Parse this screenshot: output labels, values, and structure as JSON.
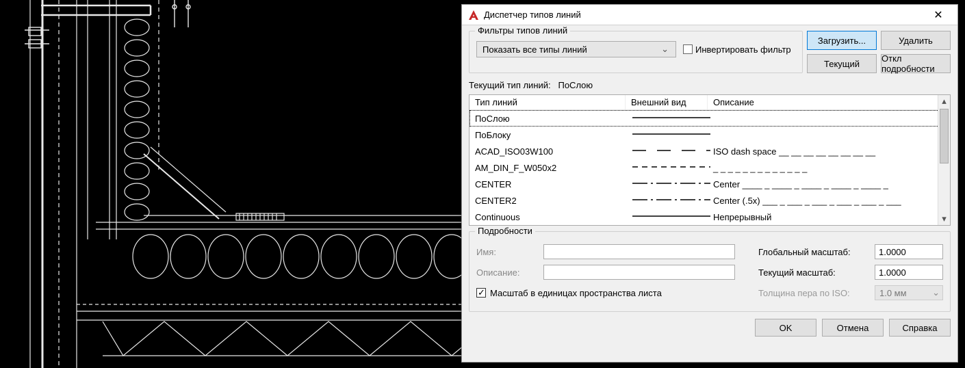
{
  "dialog": {
    "title": "Диспетчер типов линий",
    "close_icon_label": "✕"
  },
  "filters": {
    "legend": "Фильтры типов линий",
    "combo_value": "Показать все типы линий",
    "invert_label": "Инвертировать фильтр"
  },
  "buttons": {
    "load": "Загрузить...",
    "delete": "Удалить",
    "current": "Текущий",
    "toggle_details": "Откл подробности"
  },
  "current": {
    "label": "Текущий тип линий:",
    "value": "ПоСлою"
  },
  "list": {
    "headers": {
      "name": "Тип линий",
      "look": "Внешний вид",
      "desc": "Описание"
    },
    "rows": [
      {
        "name": "ПоСлою",
        "look": "solid",
        "desc": "",
        "selected": true
      },
      {
        "name": "ПоБлоку",
        "look": "solid",
        "desc": ""
      },
      {
        "name": "ACAD_ISO03W100",
        "look": "dash_space",
        "desc": "ISO dash space __  __  __  __  __  __  __  __"
      },
      {
        "name": "AM_DIN_F_W050x2",
        "look": "short_dash",
        "desc": "_ _ _ _ _ _ _ _ _ _ _ _ _"
      },
      {
        "name": "CENTER",
        "look": "center",
        "desc": "Center ____ _ ____ _ ____ _ ____ _ ____ _"
      },
      {
        "name": "CENTER2",
        "look": "center",
        "desc": "Center (.5x) ___ _ ___ _ ___ _ ___ _ ___ _ ___"
      },
      {
        "name": "Continuous",
        "look": "solid",
        "desc": "Непрерывный"
      }
    ]
  },
  "details": {
    "legend": "Подробности",
    "name_label": "Имя:",
    "name_value": "",
    "desc_label": "Описание:",
    "desc_value": "",
    "paperspace_label": "Масштаб в единицах пространства листа",
    "global_scale_label": "Глобальный масштаб:",
    "global_scale_value": "1.0000",
    "current_scale_label": "Текущий масштаб:",
    "current_scale_value": "1.0000",
    "iso_pen_label": "Толщина пера по ISO:",
    "iso_pen_value": "1.0 мм"
  },
  "footer": {
    "ok": "OK",
    "cancel": "Отмена",
    "help": "Справка"
  }
}
